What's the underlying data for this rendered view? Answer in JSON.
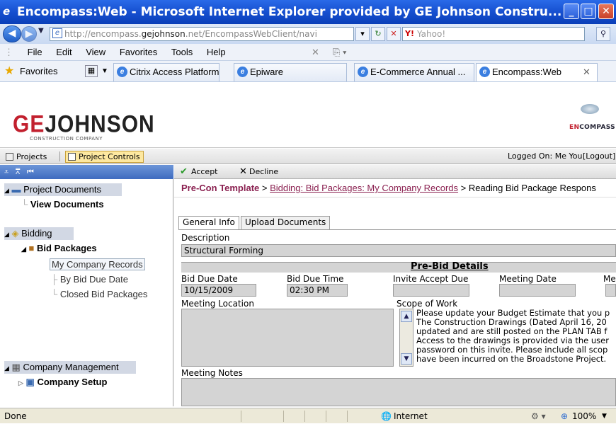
{
  "window": {
    "title": "Encompass:Web - Microsoft Internet Explorer provided by GE Johnson Constru..."
  },
  "address": {
    "url_prefix": "http://encompass.",
    "url_domain": "gejohnson",
    "url_suffix": ".net/EncompassWebClient/navi",
    "search_placeholder": "Yahoo!"
  },
  "menu": {
    "items": [
      "File",
      "Edit",
      "View",
      "Favorites",
      "Tools",
      "Help"
    ]
  },
  "favorites": {
    "label": "Favorites",
    "tabs": [
      "Citrix Access Platform",
      "Epiware",
      "E-Commerce Annual ...",
      "Encompass:Web"
    ]
  },
  "header": {
    "logo_part1": "GE",
    "logo_part2": "JOHNSON",
    "logo_sub": "CONSTRUCTION COMPANY",
    "brand_part1": "EN",
    "brand_part2": "COMPASS"
  },
  "project_tabs": {
    "items": [
      "Projects",
      "Project Controls"
    ],
    "logged_on": "Logged On: Me You",
    "logout": "[Logout]"
  },
  "left_tree": {
    "project_documents": "Project Documents",
    "view_documents": "View Documents",
    "bidding": "Bidding",
    "bid_packages": "Bid Packages",
    "my_company_records": "My Company Records",
    "by_bid_due_date": "By Bid Due Date",
    "closed_bid_packages": "Closed Bid Packages",
    "company_management": "Company Management",
    "company_setup": "Company Setup"
  },
  "toolbar": {
    "accept": "Accept",
    "decline": "Decline"
  },
  "breadcrumb": {
    "first": "Pre-Con Template",
    "sep": ">",
    "second": "Bidding: Bid Packages: My Company Records",
    "third": "Reading Bid Package Respons"
  },
  "form_tabs": {
    "general": "General Info",
    "upload": "Upload Documents"
  },
  "form": {
    "description_label": "Description",
    "description_value": "Structural Forming",
    "section_title": "Pre-Bid Details",
    "bid_due_date_label": "Bid Due Date",
    "bid_due_date_value": "10/15/2009",
    "bid_due_time_label": "Bid Due Time",
    "bid_due_time_value": "02:30 PM",
    "invite_accept_label": "Invite Accept Due",
    "meeting_date_label": "Meeting Date",
    "meeting_extra_label": "Me",
    "meeting_location_label": "Meeting Location",
    "scope_label": "Scope of Work",
    "scope_lines": [
      "Please update your Budget Estimate that you p",
      "The Construction Drawings (Dated April 16, 20",
      "updated and are still posted on the PLAN TAB f",
      "Access to the drawings is provided via the user",
      "password on this invite. Please include all scop",
      "have been incurred on the Broadstone Project."
    ],
    "meeting_notes_label": "Meeting Notes"
  },
  "status": {
    "text": "Done",
    "zone": "Internet",
    "zoom": "100%"
  }
}
